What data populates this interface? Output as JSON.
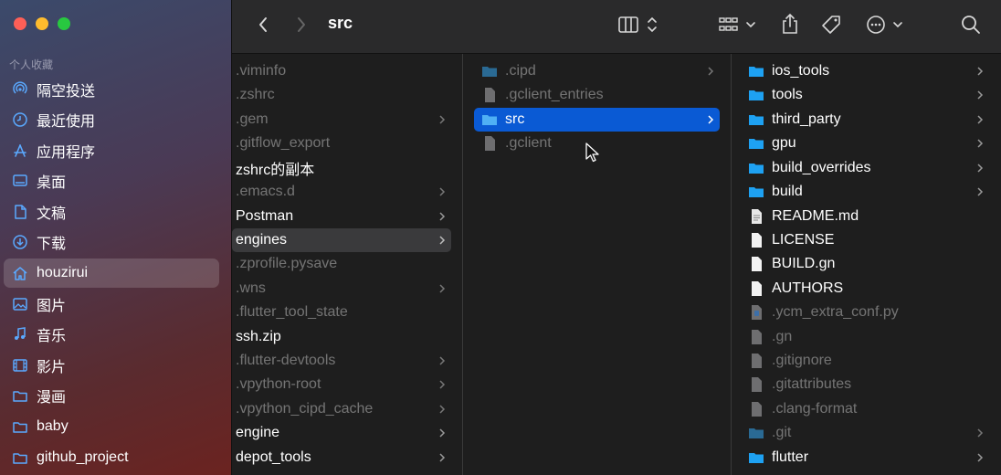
{
  "window": {
    "title": "src"
  },
  "sidebar": {
    "section_label": "个人收藏",
    "items": [
      {
        "label": "隔空投送",
        "icon": "airdrop-icon"
      },
      {
        "label": "最近使用",
        "icon": "clock-icon"
      },
      {
        "label": "应用程序",
        "icon": "applications-icon"
      },
      {
        "label": "桌面",
        "icon": "desktop-icon"
      },
      {
        "label": "文稿",
        "icon": "document-icon"
      },
      {
        "label": "下载",
        "icon": "download-icon"
      },
      {
        "label": "houzirui",
        "icon": "home-icon",
        "active": true
      },
      {
        "label": "图片",
        "icon": "photo-icon"
      },
      {
        "label": "音乐",
        "icon": "music-icon"
      },
      {
        "label": "影片",
        "icon": "film-icon"
      },
      {
        "label": "漫画",
        "icon": "folder-icon"
      },
      {
        "label": "baby",
        "icon": "folder-icon"
      },
      {
        "label": "github_project",
        "icon": "folder-icon"
      }
    ]
  },
  "toolbar": {
    "back_icon": "chevron-left-icon",
    "forward_icon": "chevron-right-icon",
    "view_icon": "columns-view-icon",
    "group_icon": "grid-group-icon",
    "share_icon": "share-icon",
    "tag_icon": "tag-icon",
    "more_icon": "ellipsis-circle-icon",
    "search_icon": "search-icon"
  },
  "columns": {
    "col1": [
      {
        "name": ".viminfo",
        "dim": true
      },
      {
        "name": ".zshrc",
        "dim": true
      },
      {
        "name": ".gem",
        "dim": true,
        "folder": true
      },
      {
        "name": ".gitflow_export",
        "dim": true
      },
      {
        "name": "zshrc的副本",
        "dim": false
      },
      {
        "name": ".emacs.d",
        "dim": true,
        "folder": true
      },
      {
        "name": "Postman",
        "dim": false,
        "folder": true
      },
      {
        "name": "engines",
        "dim": false,
        "folder": true,
        "highlight": true
      },
      {
        "name": ".zprofile.pysave",
        "dim": true
      },
      {
        "name": ".wns",
        "dim": true,
        "folder": true
      },
      {
        "name": ".flutter_tool_state",
        "dim": true
      },
      {
        "name": "ssh.zip",
        "dim": false
      },
      {
        "name": ".flutter-devtools",
        "dim": true,
        "folder": true
      },
      {
        "name": ".vpython-root",
        "dim": true,
        "folder": true
      },
      {
        "name": ".vpython_cipd_cache",
        "dim": true,
        "folder": true
      },
      {
        "name": "engine",
        "dim": false,
        "folder": true
      },
      {
        "name": "depot_tools",
        "dim": false,
        "folder": true
      }
    ],
    "col2": [
      {
        "name": ".cipd",
        "dim": true,
        "type": "folder"
      },
      {
        "name": ".gclient_entries",
        "dim": true,
        "type": "file"
      },
      {
        "name": "src",
        "dim": false,
        "type": "folder",
        "selected": true
      },
      {
        "name": ".gclient",
        "dim": true,
        "type": "file"
      }
    ],
    "col3": [
      {
        "name": "ios_tools",
        "type": "folder"
      },
      {
        "name": "tools",
        "type": "folder"
      },
      {
        "name": "third_party",
        "type": "folder"
      },
      {
        "name": "gpu",
        "type": "folder"
      },
      {
        "name": "build_overrides",
        "type": "folder"
      },
      {
        "name": "build",
        "type": "folder"
      },
      {
        "name": "README.md",
        "type": "doc"
      },
      {
        "name": "LICENSE",
        "type": "file"
      },
      {
        "name": "BUILD.gn",
        "type": "file"
      },
      {
        "name": "AUTHORS",
        "type": "file"
      },
      {
        "name": ".ycm_extra_conf.py",
        "type": "py",
        "dim": true
      },
      {
        "name": ".gn",
        "type": "file",
        "dim": true
      },
      {
        "name": ".gitignore",
        "type": "file",
        "dim": true
      },
      {
        "name": ".gitattributes",
        "type": "file",
        "dim": true
      },
      {
        "name": ".clang-format",
        "type": "file",
        "dim": true
      },
      {
        "name": ".git",
        "type": "folder",
        "dim": true
      },
      {
        "name": "flutter",
        "type": "folder"
      }
    ]
  },
  "colors": {
    "accent": "#0a5ad4",
    "folder": "#1ea1f2"
  }
}
